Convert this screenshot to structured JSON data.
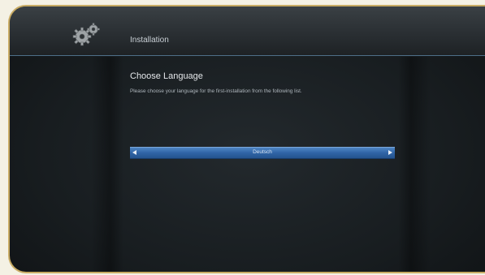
{
  "header": {
    "title": "Installation",
    "icon": "gears-icon"
  },
  "main": {
    "heading": "Choose Language",
    "description": "Please choose your language for the first-installation from the following list.",
    "language_selector": {
      "value": "Deutsch",
      "left_icon": "arrow-left-icon",
      "right_icon": "arrow-right-icon"
    }
  },
  "colors": {
    "frame": "#c8ab63",
    "background": "#181d20",
    "header_divider": "#4e6f88",
    "selection": "#2f64a6"
  }
}
